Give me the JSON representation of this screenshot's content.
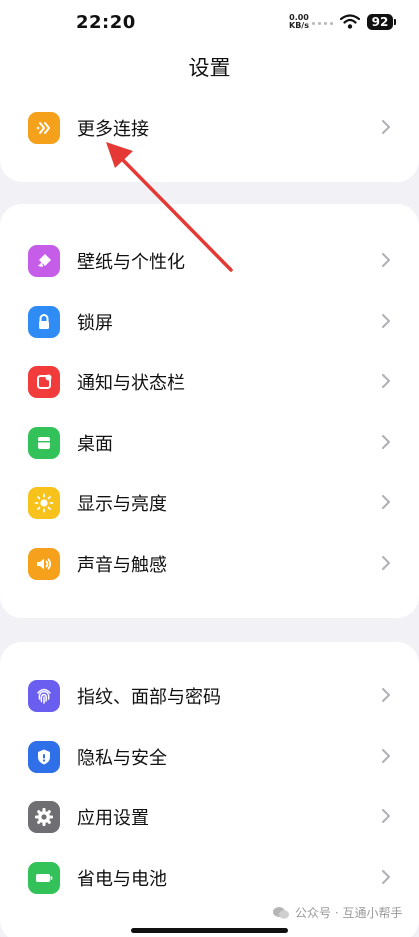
{
  "status_bar": {
    "time": "22:20",
    "net_speed_value": "0.00",
    "net_speed_unit": "KB/s",
    "battery": "92"
  },
  "header": {
    "title": "设置"
  },
  "groups": {
    "connect": {
      "items": [
        {
          "label": "更多连接",
          "icon": "more-connections-icon",
          "color": "#f5a11b"
        }
      ]
    },
    "personal": {
      "items": [
        {
          "label": "壁纸与个性化",
          "icon": "wallpaper-icon",
          "color": "#c55de8"
        },
        {
          "label": "锁屏",
          "icon": "lock-icon",
          "color": "#2f8cf5"
        },
        {
          "label": "通知与状态栏",
          "icon": "notification-icon",
          "color": "#f23b3b"
        },
        {
          "label": "桌面",
          "icon": "desktop-icon",
          "color": "#33c25a"
        },
        {
          "label": "显示与亮度",
          "icon": "brightness-icon",
          "color": "#f7c21c"
        },
        {
          "label": "声音与触感",
          "icon": "sound-icon",
          "color": "#f5a11b"
        }
      ]
    },
    "security": {
      "items": [
        {
          "label": "指纹、面部与密码",
          "icon": "fingerprint-icon",
          "color": "#6a5ef0"
        },
        {
          "label": "隐私与安全",
          "icon": "privacy-shield-icon",
          "color": "#2f6fe8"
        },
        {
          "label": "应用设置",
          "icon": "gear-icon",
          "color": "#6e6e73"
        },
        {
          "label": "省电与电池",
          "icon": "battery-icon",
          "color": "#33c25a"
        }
      ]
    }
  },
  "watermark": {
    "text": "公众号 · 互通小帮手"
  },
  "annotation": {
    "arrow_color": "#e53935"
  }
}
